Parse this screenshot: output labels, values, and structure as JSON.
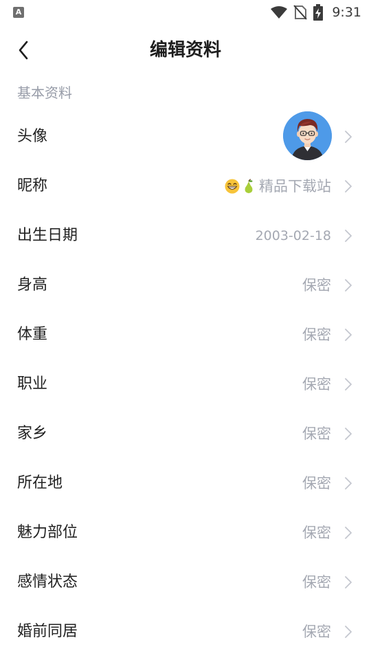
{
  "status_bar": {
    "left_icon": "A",
    "time": "9:31",
    "icons": [
      "wifi-icon",
      "no-sim-icon",
      "battery-charging-icon"
    ]
  },
  "header": {
    "back_icon": "chevron-left-icon",
    "title": "编辑资料"
  },
  "section": {
    "title": "基本资料"
  },
  "rows": [
    {
      "label": "头像",
      "type": "avatar"
    },
    {
      "label": "昵称",
      "value": "精品下载站",
      "emojis": [
        "grinning-face-emoji",
        "pear-emoji"
      ]
    },
    {
      "label": "出生日期",
      "value": "2003-02-18"
    },
    {
      "label": "身高",
      "value": "保密"
    },
    {
      "label": "体重",
      "value": "保密"
    },
    {
      "label": "职业",
      "value": "保密"
    },
    {
      "label": "家乡",
      "value": "保密"
    },
    {
      "label": "所在地",
      "value": "保密"
    },
    {
      "label": "魅力部位",
      "value": "保密"
    },
    {
      "label": "感情状态",
      "value": "保密"
    },
    {
      "label": "婚前同居",
      "value": "保密"
    }
  ],
  "colors": {
    "label": "#222222",
    "value": "#a4a8b2",
    "section": "#979ca8",
    "chevron": "#c4c7cf",
    "avatar_bg": "#4e9ae8"
  }
}
